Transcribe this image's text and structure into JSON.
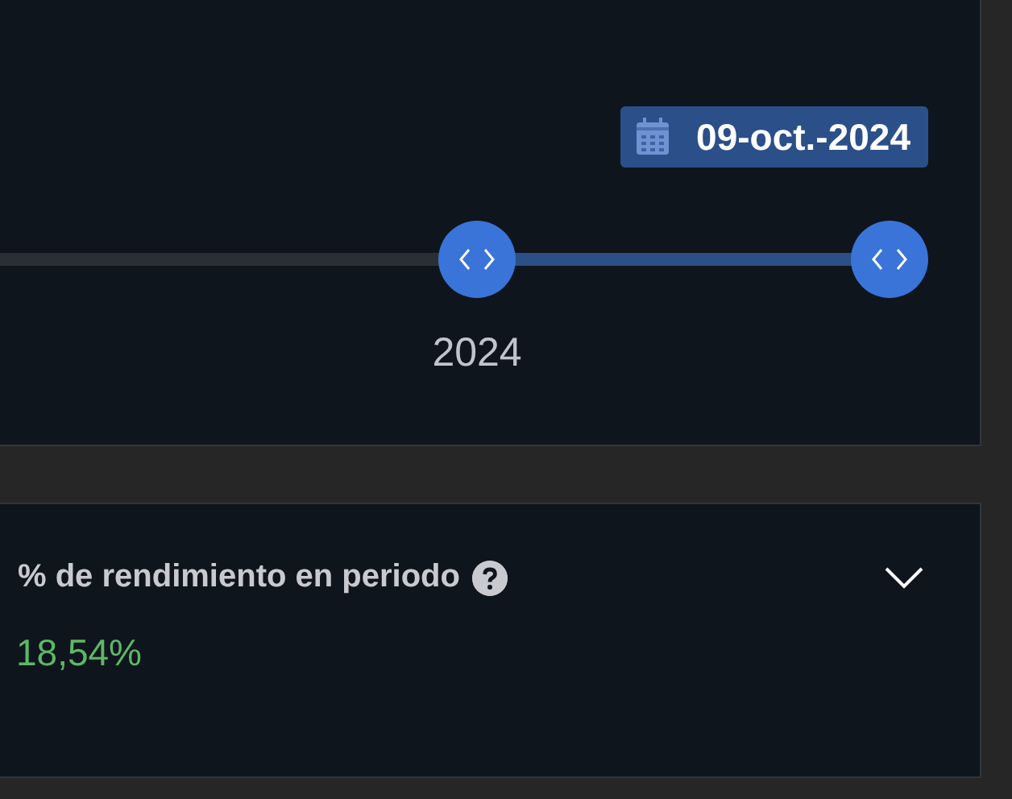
{
  "date_filter": {
    "date": "09-oct.-2024"
  },
  "timeline": {
    "year_label": "2024"
  },
  "stat_panel": {
    "title": "% de rendimiento en periodo",
    "value": "18,54%",
    "expanded": false
  }
}
